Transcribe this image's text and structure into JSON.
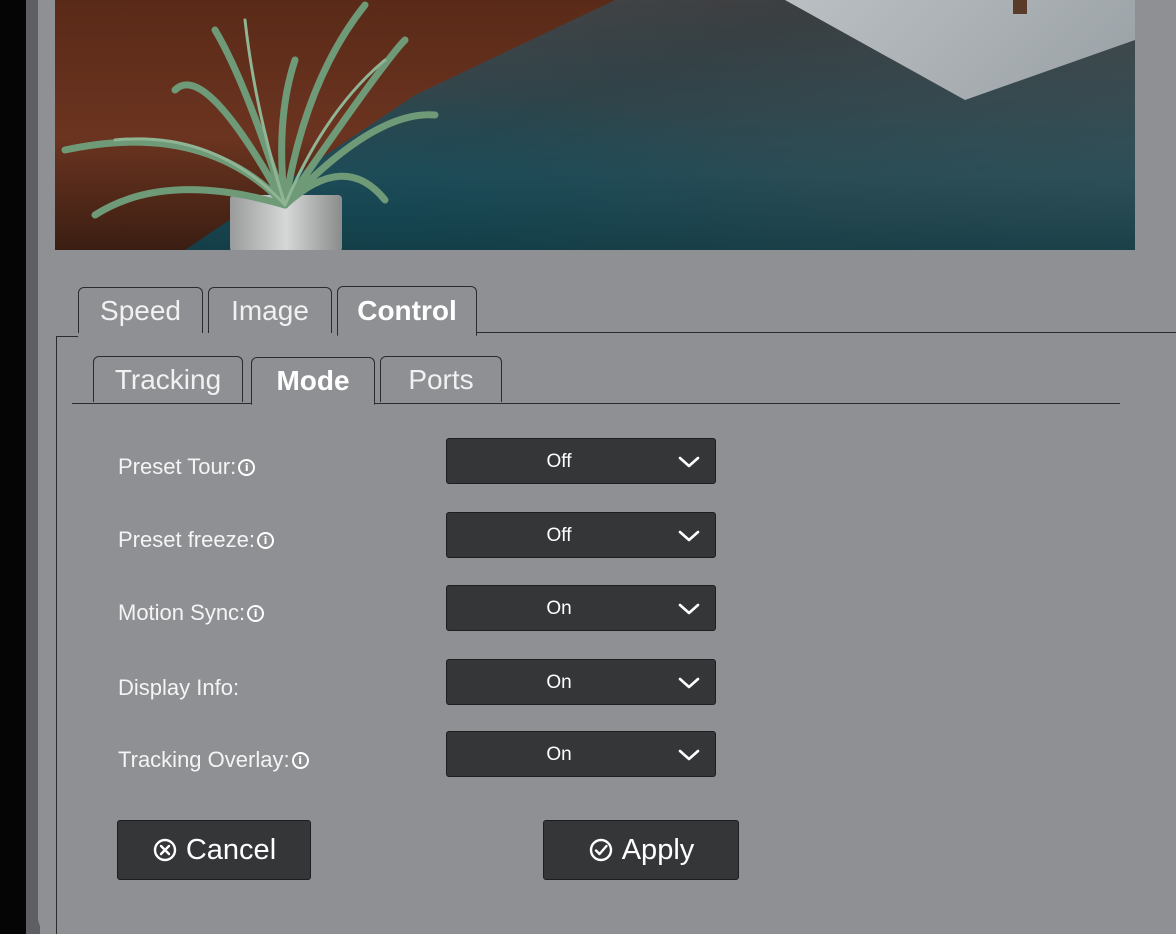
{
  "tabs": [
    {
      "label": "Speed",
      "active": false
    },
    {
      "label": "Image",
      "active": false
    },
    {
      "label": "Control",
      "active": true
    }
  ],
  "subtabs": [
    {
      "label": "Tracking",
      "active": false
    },
    {
      "label": "Mode",
      "active": true
    },
    {
      "label": "Ports",
      "active": false
    }
  ],
  "settings": [
    {
      "label": "Preset Tour:",
      "info": true,
      "value": "Off"
    },
    {
      "label": "Preset freeze:",
      "info": true,
      "value": "Off"
    },
    {
      "label": "Motion Sync:",
      "info": true,
      "value": "On"
    },
    {
      "label": "Display Info:",
      "info": false,
      "value": "On"
    },
    {
      "label": "Tracking Overlay:",
      "info": true,
      "value": "On"
    }
  ],
  "actions": {
    "cancel_label": "Cancel",
    "apply_label": "Apply"
  },
  "icons": {
    "info": "info-icon",
    "dropdown": "chevron-down-icon",
    "cancel": "circle-x-icon",
    "apply": "circle-check-icon"
  }
}
